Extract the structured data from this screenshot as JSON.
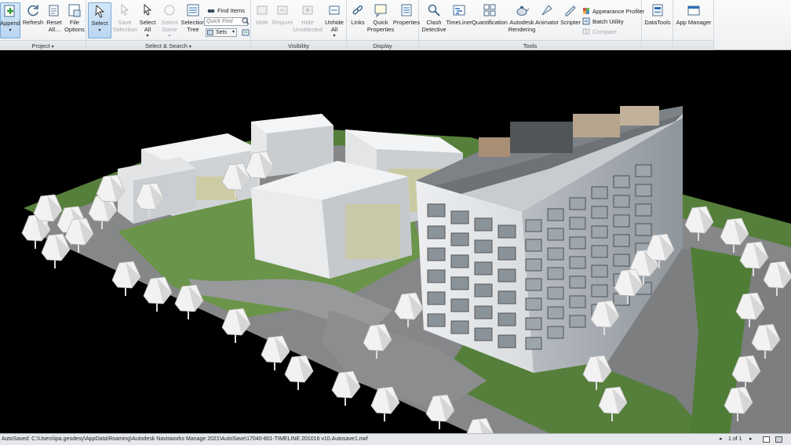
{
  "ribbon": {
    "panels": {
      "project": "Project",
      "select_search": "Select & Search",
      "visibility": "Visibility",
      "display": "Display",
      "tools": "Tools"
    },
    "project": {
      "append": "Append",
      "refresh": "Refresh",
      "reset_all": [
        "Reset",
        "All..."
      ],
      "file_options": [
        "File",
        "Options"
      ]
    },
    "select_search": {
      "select": "Select",
      "save_selection": [
        "Save",
        "Selection"
      ],
      "select_all": [
        "Select",
        "All"
      ],
      "select_same": [
        "Select",
        "Same"
      ],
      "selection_tree": [
        "Selection",
        "Tree"
      ],
      "find_items": "Find Items",
      "quick_find_placeholder": "Quick Find",
      "sets": "Sets"
    },
    "visibility": {
      "hide": "Hide",
      "require": "Require",
      "hide_unselected": [
        "Hide",
        "Unselected"
      ],
      "unhide_all": [
        "Unhide",
        "All"
      ]
    },
    "display": {
      "links": "Links",
      "quick_properties": [
        "Quick",
        "Properties"
      ],
      "properties": "Properties"
    },
    "tools": {
      "clash_detective": [
        "Clash",
        "Detective"
      ],
      "timeliner": "TimeLiner",
      "quantification": "Quantification",
      "autodesk_rendering": [
        "Autodesk",
        "Rendering"
      ],
      "animator": "Animator",
      "scripter": "Scripter",
      "appearance_profiler": "Appearance Profiler",
      "batch_utility": "Batch Utility",
      "compare": "Compare"
    },
    "datatools": "DataTools",
    "app_manager": "App Manager"
  },
  "status": {
    "path": "AutoSaved: C:\\Users\\ipa.geodesy\\AppData\\Roaming\\Autodesk Navisworks Manage 2021\\AutoSave\\17040-801-TIMELINE 201016 v10.Autosave1.nwf",
    "page": "1 of 1"
  },
  "colors": {
    "accent": "#2a6fb8",
    "grass": "#5b8f3f",
    "road": "#8d8f91",
    "facade": "#e4e6e8",
    "glass": "#9fa8b0"
  }
}
